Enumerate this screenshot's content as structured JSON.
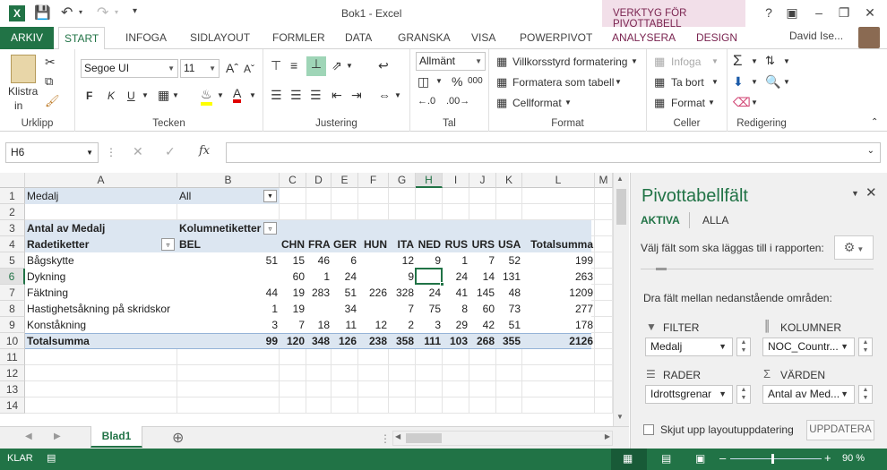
{
  "window": {
    "title": "Bok1 - Excel",
    "context_band": "VERKTYG FÖR PIVOTTABELL",
    "help": "?",
    "user": "David Ise..."
  },
  "tabs": [
    "ARKIV",
    "START",
    "INFOGA",
    "SIDLAYOUT",
    "FORMLER",
    "DATA",
    "GRANSKA",
    "VISA",
    "POWERPIVOT",
    "ANALYSERA",
    "DESIGN"
  ],
  "ribbon": {
    "clipboard": {
      "paste": "Klistra",
      "paste2": "in",
      "label": "Urklipp"
    },
    "font": {
      "name": "Segoe UI",
      "size": "11",
      "label": "Tecken",
      "bold": "F",
      "italic": "K",
      "underline": "U"
    },
    "alignment": {
      "label": "Justering"
    },
    "number": {
      "format": "Allmänt",
      "percent": "%",
      "comma": "000",
      "label": "Tal"
    },
    "styles": {
      "conditional": "Villkorsstyrd formatering",
      "as_table": "Formatera som tabell",
      "cell_styles": "Cellformat",
      "label": "Format"
    },
    "cells": {
      "insert": "Infoga",
      "delete": "Ta bort",
      "format": "Format",
      "label": "Celler"
    },
    "editing": {
      "label": "Redigering"
    }
  },
  "formula_bar": {
    "name_box": "H6",
    "fx": "fx",
    "value": ""
  },
  "grid": {
    "columns": [
      "A",
      "B",
      "C",
      "D",
      "E",
      "F",
      "G",
      "H",
      "I",
      "J",
      "K",
      "L",
      "M"
    ],
    "rows": [
      "1",
      "2",
      "3",
      "4",
      "5",
      "6",
      "7",
      "8",
      "9",
      "10",
      "11",
      "12",
      "13",
      "14"
    ],
    "selected_column": "H",
    "selected_row": "6",
    "filter_label": "Medalj",
    "filter_value": "All",
    "count_label": "Antal av Medalj",
    "col_labels": "Kolumnetiketter",
    "row_labels": "Radetiketter",
    "countries": [
      "BEL",
      "CHN",
      "FRA",
      "GER",
      "HUN",
      "ITA",
      "NED",
      "RUS",
      "URS",
      "USA",
      "Totalsumma"
    ],
    "data_rows": [
      {
        "label": "Bågskytte",
        "values": [
          "51",
          "15",
          "46",
          "6",
          "",
          "12",
          "9",
          "1",
          "7",
          "52",
          "199"
        ]
      },
      {
        "label": "Dykning",
        "values": [
          "",
          "60",
          "1",
          "24",
          "",
          "9",
          "",
          "24",
          "14",
          "131",
          "263"
        ]
      },
      {
        "label": "Fäktning",
        "values": [
          "44",
          "19",
          "283",
          "51",
          "226",
          "328",
          "24",
          "41",
          "145",
          "48",
          "1209"
        ]
      },
      {
        "label": "Hastighetsåkning på skridskor",
        "values": [
          "1",
          "19",
          "",
          "34",
          "",
          "7",
          "75",
          "8",
          "60",
          "73",
          "277"
        ]
      },
      {
        "label": "Konståkning",
        "values": [
          "3",
          "7",
          "18",
          "11",
          "12",
          "2",
          "3",
          "29",
          "42",
          "51",
          "178"
        ]
      }
    ],
    "total_row": {
      "label": "Totalsumma",
      "values": [
        "99",
        "120",
        "348",
        "126",
        "238",
        "358",
        "111",
        "103",
        "268",
        "355",
        "2126"
      ]
    }
  },
  "sheets": {
    "active": "Blad1",
    "add": "⊕"
  },
  "status": {
    "mode": "KLAR",
    "zoom": "90 %"
  },
  "pivot_pane": {
    "title": "Pivottabellfält",
    "tab_active": "AKTIVA",
    "tab_all": "ALLA",
    "choose_fields": "Välj fält som ska läggas till i rapporten:",
    "drag_text": "Dra fält mellan nedanstående områden:",
    "filter_header": "FILTER",
    "columns_header": "KOLUMNER",
    "rows_header": "RADER",
    "values_header": "VÄRDEN",
    "filter_field": "Medalj",
    "columns_field": "NOC_Countr...",
    "rows_field": "Idrottsgrenar",
    "values_field": "Antal av Med...",
    "defer_label": "Skjut upp layoutuppdatering",
    "update_button": "UPPDATERA"
  }
}
